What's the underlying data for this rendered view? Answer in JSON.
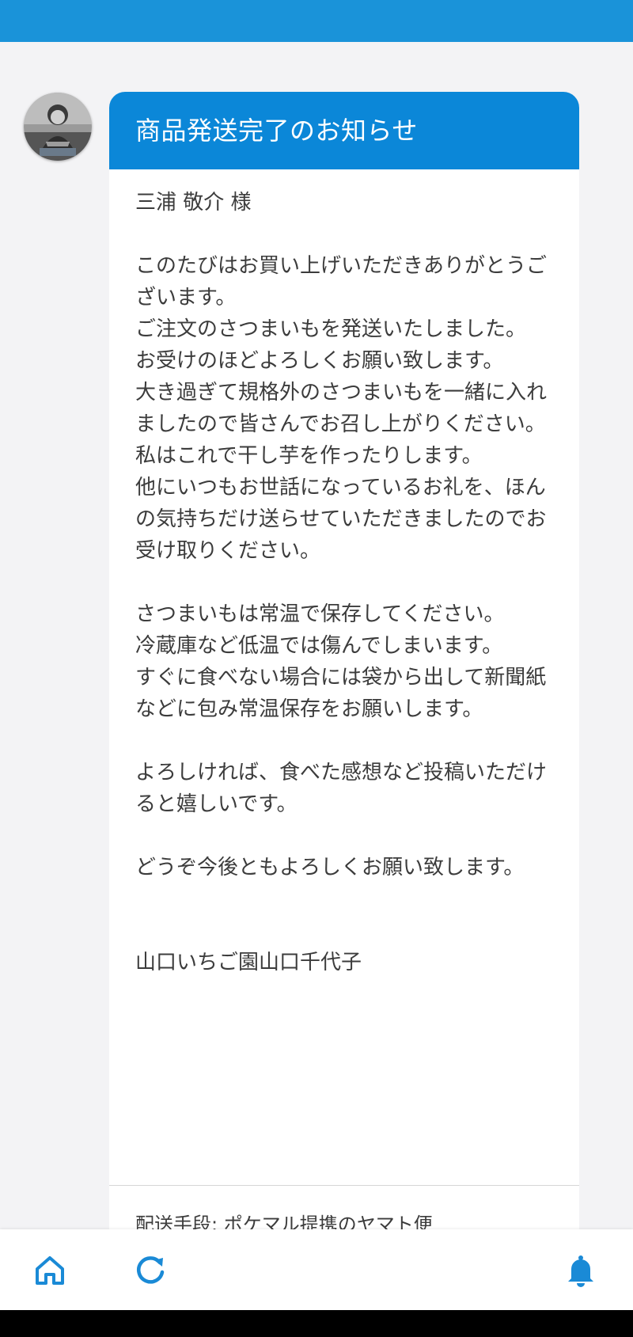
{
  "colors": {
    "topbar": "#1a93d9",
    "card_header": "#0b87d8",
    "nav_icon": "#1a8ad6",
    "background": "#f3f3f5"
  },
  "avatar": {
    "icon": "user-avatar-photo"
  },
  "message": {
    "title": "商品発送完了のお知らせ",
    "salutation": "三浦 敬介 様",
    "paragraphs": [
      "このたびはお買い上げいただきありがとうございます。\nご注文のさつまいもを発送いたしました。\nお受けのほどよろしくお願い致します。\n大き過ぎて規格外のさつまいもを一緒に入れましたので皆さんでお召し上がりください。私はこれで干し芋を作ったりします。\n他にいつもお世話になっているお礼を、ほんの気持ちだけ送らせていただきましたのでお受け取りください。",
      "さつまいもは常温で保存してください。\n冷蔵庫など低温では傷んでしまいます。\nすぐに食べない場合には袋から出して新聞紙などに包み常温保存をお願いします。",
      "よろしければ、食べた感想など投稿いただけると嬉しいです。",
      "どうぞ今後ともよろしくお願い致します。"
    ],
    "signature": "山口いちご園山口千代子",
    "shipping_method": "配送手段: ポケマル提携のヤマト便"
  },
  "bottom_nav": [
    {
      "name": "home",
      "icon": "home-icon"
    },
    {
      "name": "refresh",
      "icon": "refresh-icon"
    },
    {
      "name": "notifications",
      "icon": "bell-icon"
    }
  ]
}
